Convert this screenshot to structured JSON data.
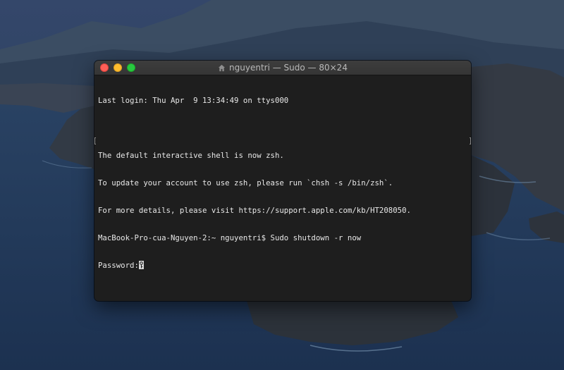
{
  "window": {
    "title": "nguyentri — Sudo — 80×24",
    "icons": {
      "home": "house-icon"
    }
  },
  "terminal": {
    "lines": [
      "Last login: Thu Apr  9 13:34:49 on ttys000",
      "",
      "The default interactive shell is now zsh.",
      "To update your account to use zsh, please run `chsh -s /bin/zsh`.",
      "For more details, please visit https://support.apple.com/kb/HT208050.",
      "MacBook-Pro-cua-Nguyen-2:~ nguyentri$ Sudo shutdown -r now"
    ],
    "password_prompt": "Password:",
    "cursor_icon": "key-icon"
  },
  "colors": {
    "close": "#fe5f57",
    "minimize": "#febc2e",
    "zoom": "#28c840",
    "terminal_bg": "#1e1e1e",
    "terminal_text": "#e8e8e8"
  }
}
